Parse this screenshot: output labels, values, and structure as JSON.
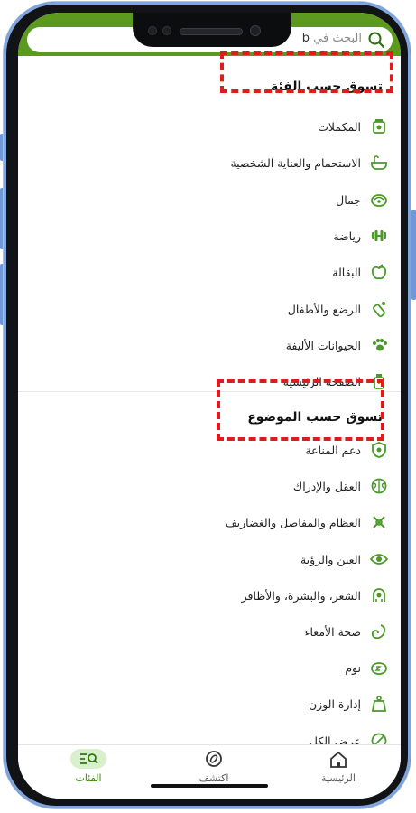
{
  "search": {
    "placeholder_prefix": "البحث في",
    "typed": "b"
  },
  "section_category": {
    "title": "تسوق حسب الفئة",
    "items": [
      {
        "label": "المكملات",
        "icon": "supplements-icon"
      },
      {
        "label": "الاستحمام والعناية الشخصية",
        "icon": "bath-icon"
      },
      {
        "label": "جمال",
        "icon": "beauty-icon"
      },
      {
        "label": "رياضة",
        "icon": "dumbbell-icon"
      },
      {
        "label": "البقالة",
        "icon": "grocery-apple-icon"
      },
      {
        "label": "الرضع والأطفال",
        "icon": "baby-bottle-icon"
      },
      {
        "label": "الحيوانات الأليفة",
        "icon": "paw-icon"
      },
      {
        "label": "الصفحة الرئيسية",
        "icon": "home-jar-icon"
      }
    ]
  },
  "section_topic": {
    "title": "تسوق حسب الموضوع",
    "items": [
      {
        "label": "دعم المناعة",
        "icon": "immune-shield-icon"
      },
      {
        "label": "العقل والإدراك",
        "icon": "brain-icon"
      },
      {
        "label": "العظام والمفاصل والغضاريف",
        "icon": "bone-icon"
      },
      {
        "label": "العين والرؤية",
        "icon": "eye-icon"
      },
      {
        "label": "الشعر، والبشرة، والأظافر",
        "icon": "hair-skin-icon"
      },
      {
        "label": "صحة الأمعاء",
        "icon": "gut-icon"
      },
      {
        "label": "نوم",
        "icon": "sleep-icon"
      },
      {
        "label": "إدارة الوزن",
        "icon": "weight-icon"
      },
      {
        "label": "عرض الكل",
        "icon": "view-all-icon"
      }
    ]
  },
  "tabs": [
    {
      "label": "الرئيسية",
      "icon": "home-icon",
      "active": false
    },
    {
      "label": "اكتشف",
      "icon": "compass-icon",
      "active": false
    },
    {
      "label": "الفئات",
      "icon": "categories-search-icon",
      "active": true
    }
  ],
  "colors": {
    "brand_green": "#5b9a1e",
    "icon_green": "#4a9a2a",
    "highlight_red": "#e01b1b",
    "frame_blue": "#7fa6de"
  }
}
